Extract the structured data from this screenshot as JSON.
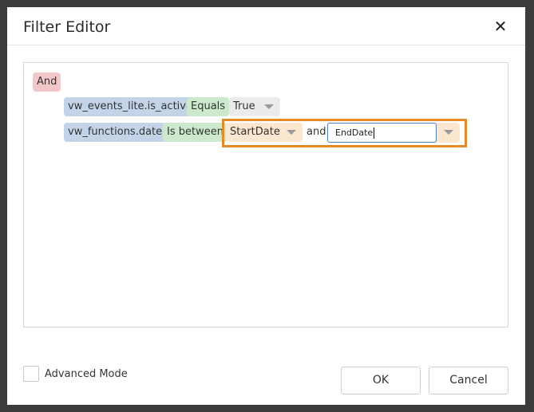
{
  "dialog": {
    "title": "Filter Editor",
    "close_icon": "close-icon"
  },
  "filter": {
    "group_operator": "And",
    "conditions": [
      {
        "field": "vw_events_lite.is_active",
        "operator": "Equals",
        "value": "True"
      },
      {
        "field": "vw_functions.date",
        "operator": "Is between",
        "value_from": "StartDate",
        "connector": "and",
        "value_to": "EndDate"
      }
    ]
  },
  "footer": {
    "advanced_mode_label": "Advanced Mode",
    "advanced_mode_checked": false,
    "ok_label": "OK",
    "cancel_label": "Cancel"
  },
  "colors": {
    "group": "#f3c7c9",
    "field": "#c3d4e8",
    "operator": "#cde9cd",
    "value": "#ebebeb",
    "value_param": "#fbe6cf",
    "highlight": "#e58a25"
  }
}
